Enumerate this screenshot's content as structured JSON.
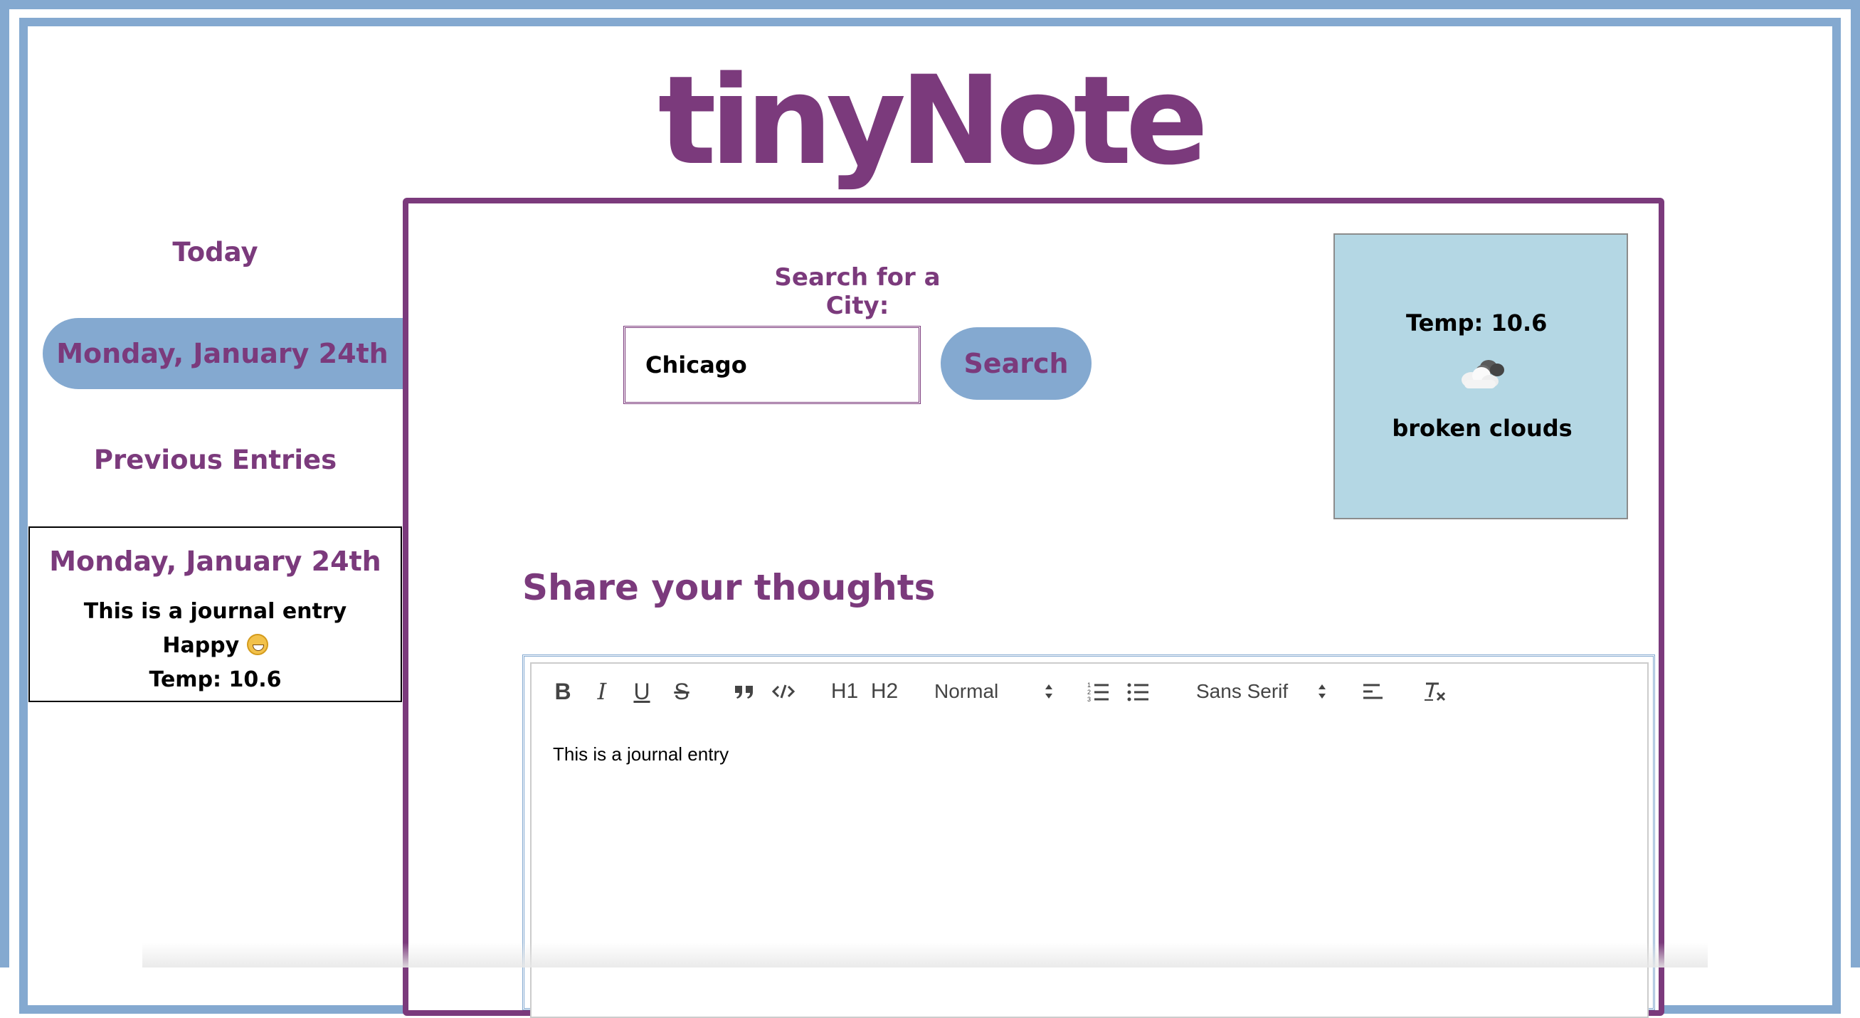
{
  "app": {
    "title": "tinyNote"
  },
  "sidebar": {
    "today_heading": "Today",
    "today_date": "Monday, January 24th",
    "previous_heading": "Previous Entries",
    "entries": [
      {
        "date": "Monday, January 24th",
        "text": "This is a journal entry",
        "mood": "Happy",
        "mood_icon": "grinning-face-icon",
        "temp": "Temp: 10.6"
      }
    ]
  },
  "search": {
    "label": "Search for a City:",
    "value": "Chicago",
    "button_label": "Search"
  },
  "weather": {
    "temp": "Temp: 10.6",
    "icon": "broken-clouds-icon",
    "description": "broken clouds"
  },
  "journal": {
    "heading": "Share your thoughts",
    "editor_content": "This is a journal entry",
    "toolbar": {
      "bold": "B",
      "italic": "I",
      "underline": "U",
      "strike": "S",
      "blockquote_icon": "blockquote-icon",
      "code_icon": "code-block-icon",
      "h1": "H1",
      "h2": "H2",
      "header_select": "Normal",
      "ordered_list_icon": "ordered-list-icon",
      "bullet_list_icon": "bullet-list-icon",
      "font_select": "Sans Serif",
      "align_icon": "align-left-icon",
      "clean_icon": "clear-formatting-icon"
    }
  },
  "colors": {
    "brand_purple": "#7b3a7c",
    "accent_blue": "#84a9d0",
    "weather_bg": "#b4d7e4"
  }
}
